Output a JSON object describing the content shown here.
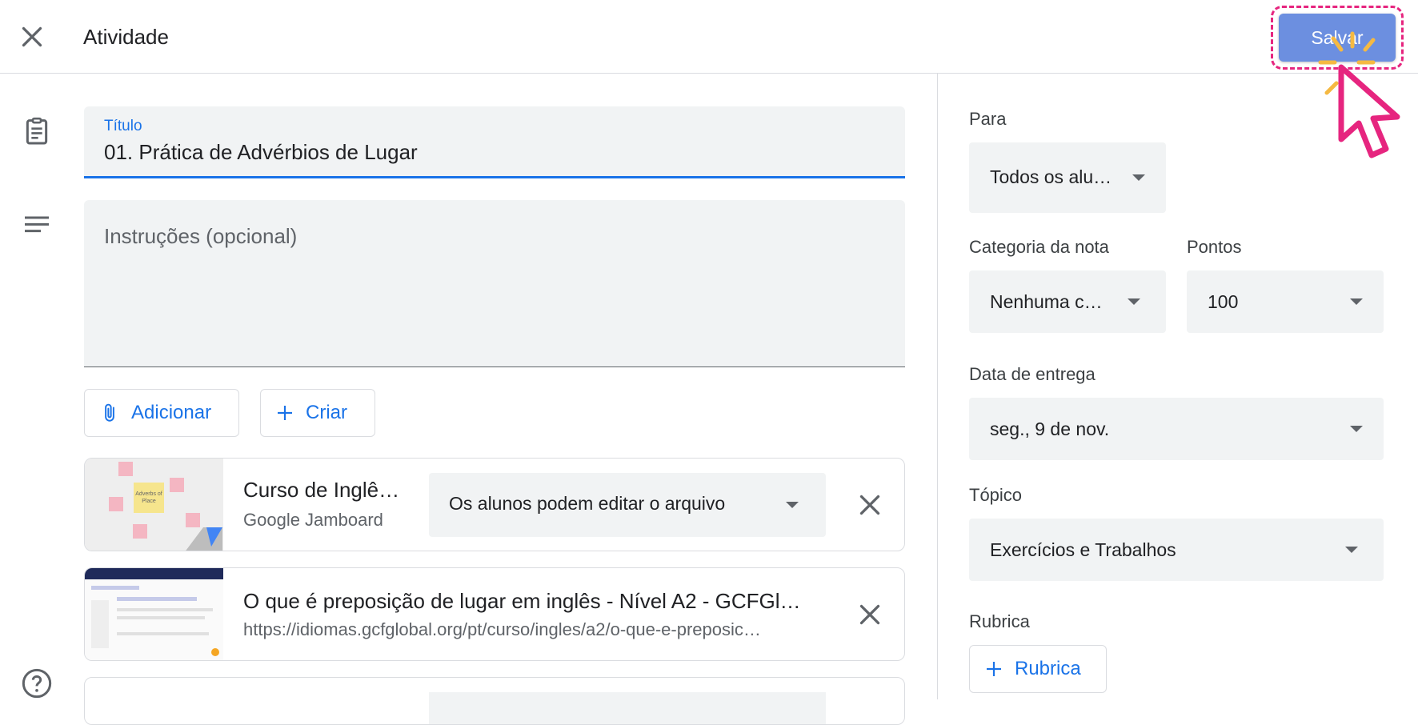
{
  "header": {
    "title": "Atividade",
    "save_label": "Salvar"
  },
  "form": {
    "title_label": "Título",
    "title_value": "01. Prática de Advérbios de Lugar",
    "instructions_placeholder": "Instruções (opcional)",
    "add_label": "Adicionar",
    "create_label": "Criar"
  },
  "attachments": [
    {
      "title": "Curso de Inglê…",
      "subtitle": "Google Jamboard",
      "permission": "Os alunos podem editar o arquivo",
      "thumb_text": "Adverbs of Place"
    },
    {
      "title": "O que é preposição de lugar em inglês - Nível A2 - GCFGl…",
      "subtitle": "https://idiomas.gcfglobal.org/pt/curso/ingles/a2/o-que-e-preposic…"
    }
  ],
  "side": {
    "for_label": "Para",
    "for_value": "Todos os alu…",
    "grade_category_label": "Categoria da nota",
    "grade_category_value": "Nenhuma c…",
    "points_label": "Pontos",
    "points_value": "100",
    "due_label": "Data de entrega",
    "due_value": "seg., 9 de nov.",
    "topic_label": "Tópico",
    "topic_value": "Exercícios e Trabalhos",
    "rubric_label": "Rubrica",
    "rubric_button": "Rubrica"
  },
  "colors": {
    "accent": "#1a73e8",
    "save_button": "#6c8fe0",
    "highlight": "#e6257f",
    "spark": "#f5b942"
  },
  "icons": [
    "close-icon",
    "assignment-icon",
    "notes-icon",
    "help-icon",
    "paperclip-icon",
    "plus-icon",
    "chevron-down-icon",
    "cursor-pointer-icon"
  ]
}
